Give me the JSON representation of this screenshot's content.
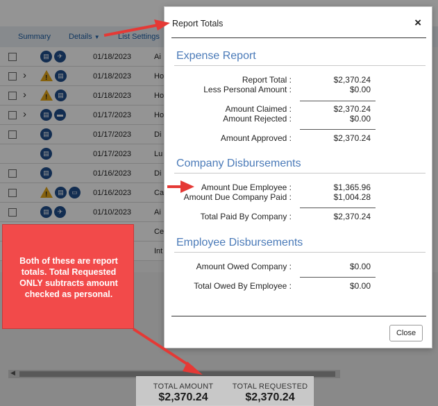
{
  "background": {
    "nav": {
      "summary": "Summary",
      "details": "Details",
      "list_settings": "List Settings"
    },
    "rows": [
      {
        "checkbox": true,
        "chevron": false,
        "icons": [
          "receipt-icon",
          "airplane-icon"
        ],
        "date": "01/18/2023",
        "type": "Ai"
      },
      {
        "checkbox": true,
        "chevron": true,
        "icons": [
          "warning-icon",
          "receipt-icon"
        ],
        "date": "01/18/2023",
        "type": "Ho"
      },
      {
        "checkbox": true,
        "chevron": true,
        "icons": [
          "warning-icon",
          "receipt-icon"
        ],
        "date": "01/18/2023",
        "type": "Ho"
      },
      {
        "checkbox": true,
        "chevron": true,
        "icons": [
          "receipt-icon",
          "bed-icon"
        ],
        "date": "01/17/2023",
        "type": "Ho"
      },
      {
        "checkbox": true,
        "chevron": false,
        "icons": [
          "receipt-icon"
        ],
        "date": "01/17/2023",
        "type": "Di"
      },
      {
        "checkbox": false,
        "chevron": false,
        "icons": [
          "receipt-icon"
        ],
        "date": "01/17/2023",
        "type": "Lu"
      },
      {
        "checkbox": true,
        "chevron": false,
        "icons": [
          "receipt-icon"
        ],
        "date": "01/16/2023",
        "type": "Di"
      },
      {
        "checkbox": true,
        "chevron": false,
        "icons": [
          "warning-icon",
          "receipt-icon",
          "chat-icon"
        ],
        "date": "01/16/2023",
        "type": "Ca"
      },
      {
        "checkbox": true,
        "chevron": false,
        "icons": [
          "receipt-icon",
          "airplane-icon"
        ],
        "date": "01/10/2023",
        "type": "Ai"
      },
      {
        "checkbox": false,
        "chevron": false,
        "icons": [],
        "date": "",
        "type": "Ce"
      },
      {
        "checkbox": false,
        "chevron": false,
        "icons": [],
        "date": "",
        "type": "Int"
      }
    ],
    "totals": {
      "total_amount_label": "TOTAL AMOUNT",
      "total_amount_value": "$2,370.24",
      "total_requested_label": "TOTAL REQUESTED",
      "total_requested_value": "$2,370.24"
    }
  },
  "callout": {
    "text": "Both of these are report totals.  Total Requested ONLY subtracts amount checked as personal."
  },
  "modal": {
    "title": "Report Totals",
    "close_x": "×",
    "close_button": "Close",
    "sections": {
      "expense_report": {
        "title": "Expense Report",
        "report_total_label": "Report Total :",
        "report_total_value": "$2,370.24",
        "less_personal_label": "Less Personal Amount :",
        "less_personal_value": "$0.00",
        "amount_claimed_label": "Amount Claimed :",
        "amount_claimed_value": "$2,370.24",
        "amount_rejected_label": "Amount Rejected :",
        "amount_rejected_value": "$0.00",
        "amount_approved_label": "Amount Approved :",
        "amount_approved_value": "$2,370.24"
      },
      "company_disbursements": {
        "title": "Company Disbursements",
        "due_employee_label": "Amount Due Employee :",
        "due_employee_value": "$1,365.96",
        "due_company_paid_label": "Amount Due Company Paid :",
        "due_company_paid_value": "$1,004.28",
        "total_paid_label": "Total Paid By Company :",
        "total_paid_value": "$2,370.24"
      },
      "employee_disbursements": {
        "title": "Employee Disbursements",
        "owed_company_label": "Amount Owed Company :",
        "owed_company_value": "$0.00",
        "owed_by_employee_label": "Total Owed By Employee :",
        "owed_by_employee_value": "$0.00"
      }
    }
  },
  "colors": {
    "section_title": "#4a7ab8",
    "callout_bg": "#f24a4a",
    "arrow": "#e53935",
    "icon_blue": "#1f4e8c",
    "warning": "#e6a817"
  }
}
